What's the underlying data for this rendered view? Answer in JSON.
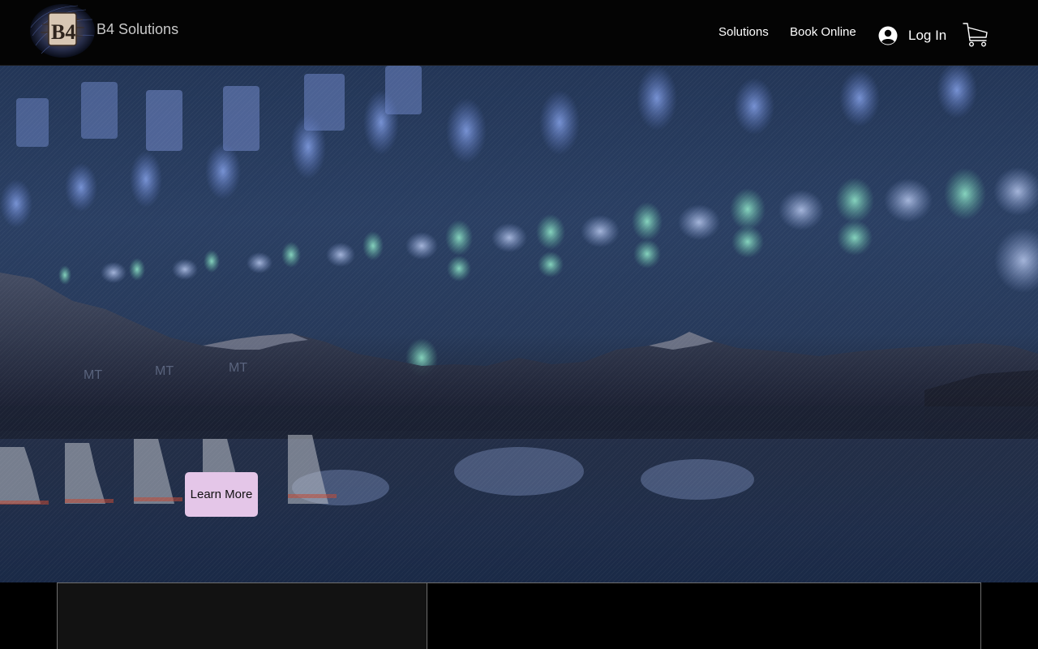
{
  "header": {
    "brand": "B4 Solutions",
    "logo_icon": "b4-circuit-logo-icon",
    "nav": [
      {
        "label": "Solutions"
      },
      {
        "label": "Book Online"
      }
    ],
    "login_label": "Log In",
    "login_icon": "user-avatar-icon",
    "cart_icon": "shopping-cart-icon"
  },
  "hero": {
    "cta_label": "Learn More",
    "background_description_icon": "mixing-console-lake-background-image"
  },
  "colors": {
    "header_bg": "#040404",
    "cta_bg": "#e4c6e8",
    "hero_tint": "#233657",
    "panel_border": "#6e6e6e"
  }
}
